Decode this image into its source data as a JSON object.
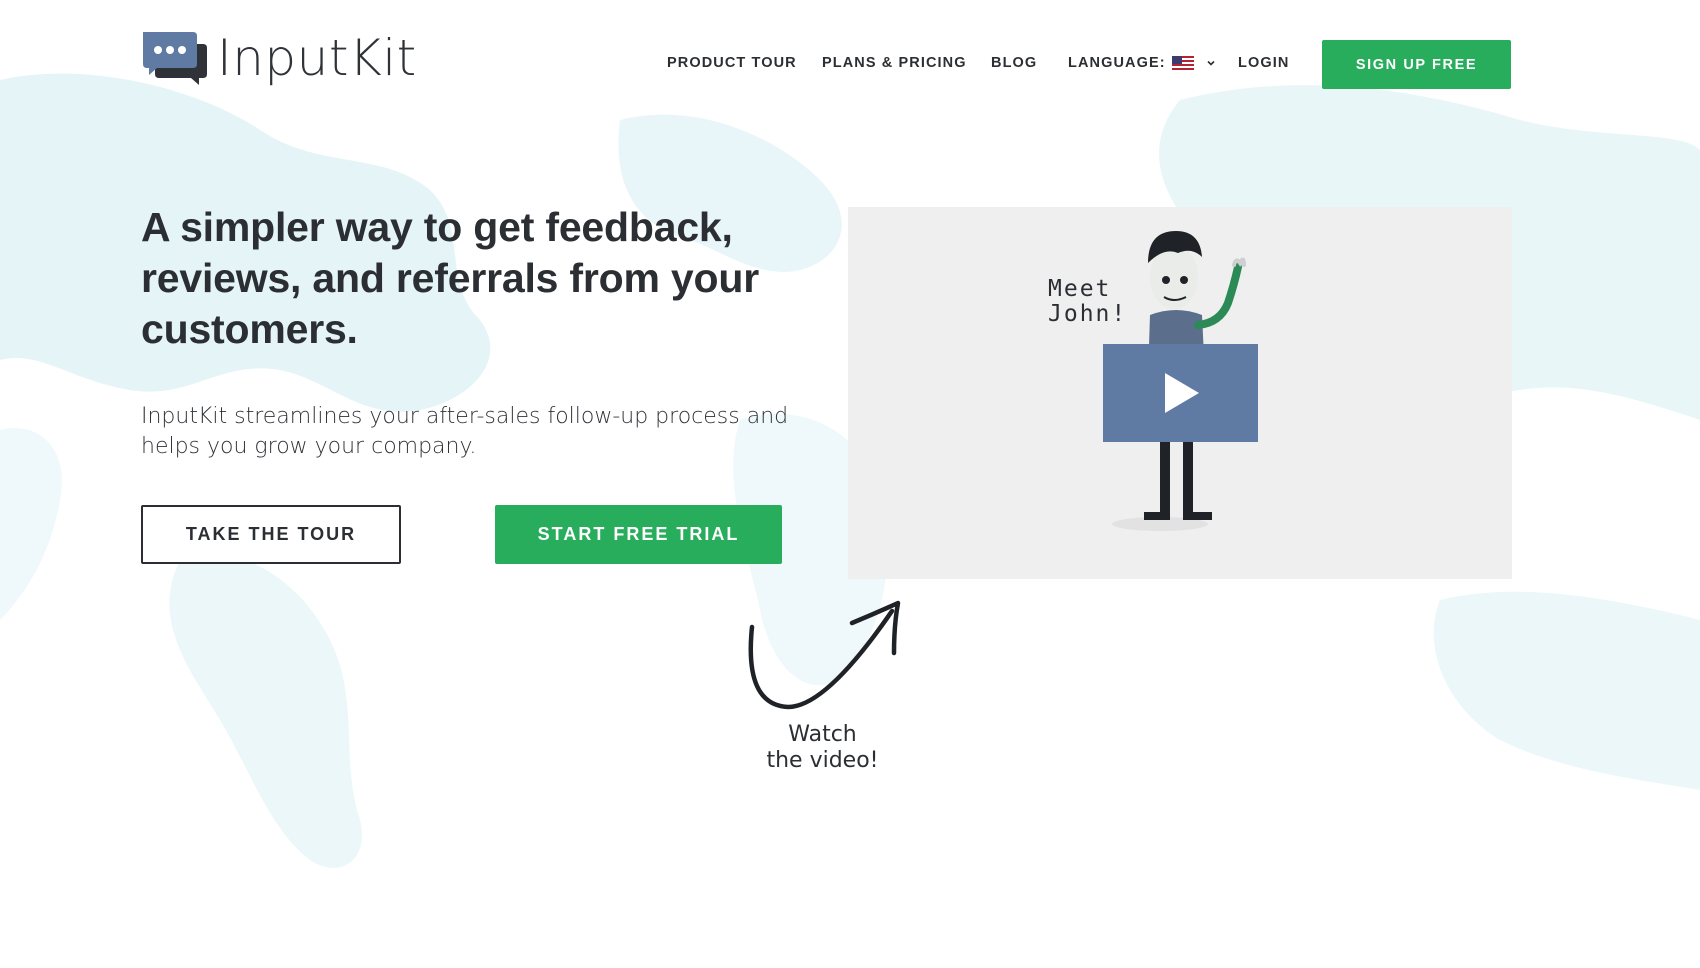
{
  "brand": {
    "name": "InputKit",
    "color": "#2b2f33",
    "logo_icon": "chat-bubbles-icon"
  },
  "nav": {
    "product_tour": "PRODUCT TOUR",
    "plans_pricing": "PLANS & PRICING",
    "blog": "BLOG",
    "language_label": "LANGUAGE:",
    "language_flag": "us-flag-icon",
    "login": "LOGIN",
    "signup": "SIGN UP FREE"
  },
  "hero": {
    "headline": "A simpler way to get feedback, reviews, and referrals from your customers.",
    "subtext": "InputKit streamlines your after-sales follow-up process and helps you grow your company.",
    "tour_button": "TAKE THE TOUR",
    "trial_button": "START FREE TRIAL"
  },
  "video": {
    "caption_line1": "Meet",
    "caption_line2": "John!",
    "play_icon": "play-icon",
    "play_color": "#5f7aa3"
  },
  "callout": {
    "line1": "Watch",
    "line2": "the video!"
  },
  "colors": {
    "accent": "#27ad5c",
    "text": "#2b2f33",
    "map": "#e6f5f8"
  }
}
